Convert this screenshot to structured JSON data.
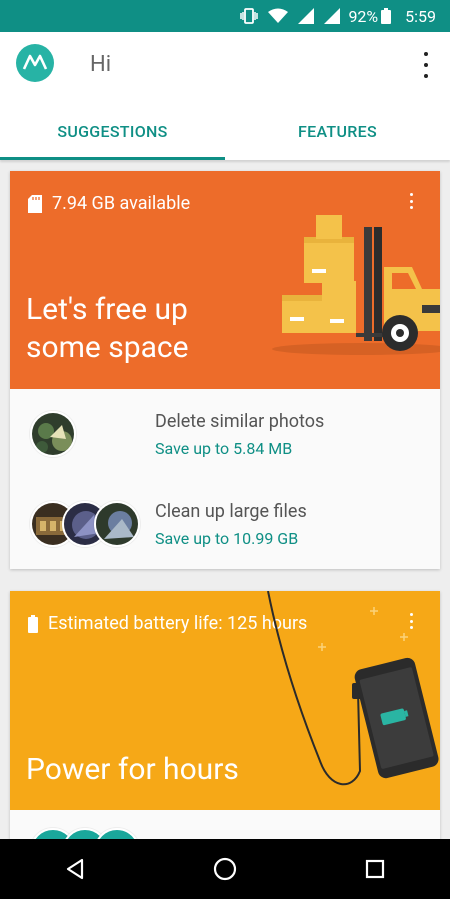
{
  "status_bar": {
    "battery_percent": "92%",
    "time": "5:59"
  },
  "app_bar": {
    "title": "Hi"
  },
  "tabs": [
    {
      "label": "SUGGESTIONS",
      "active": true
    },
    {
      "label": "FEATURES",
      "active": false
    }
  ],
  "cards": {
    "storage": {
      "top_label": "7.94 GB available",
      "headline_line1": "Let's free up",
      "headline_line2": "some space",
      "items": [
        {
          "title": "Delete similar photos",
          "subtitle": "Save up to 5.84 MB"
        },
        {
          "title": "Clean up large files",
          "subtitle": "Save up to 10.99 GB"
        }
      ]
    },
    "battery": {
      "top_label": "Estimated battery life: 125 hours",
      "headline": "Power for hours"
    }
  },
  "colors": {
    "accent": "#0f8f85",
    "storage_card": "#ed6c2a",
    "battery_card": "#f6a817"
  }
}
